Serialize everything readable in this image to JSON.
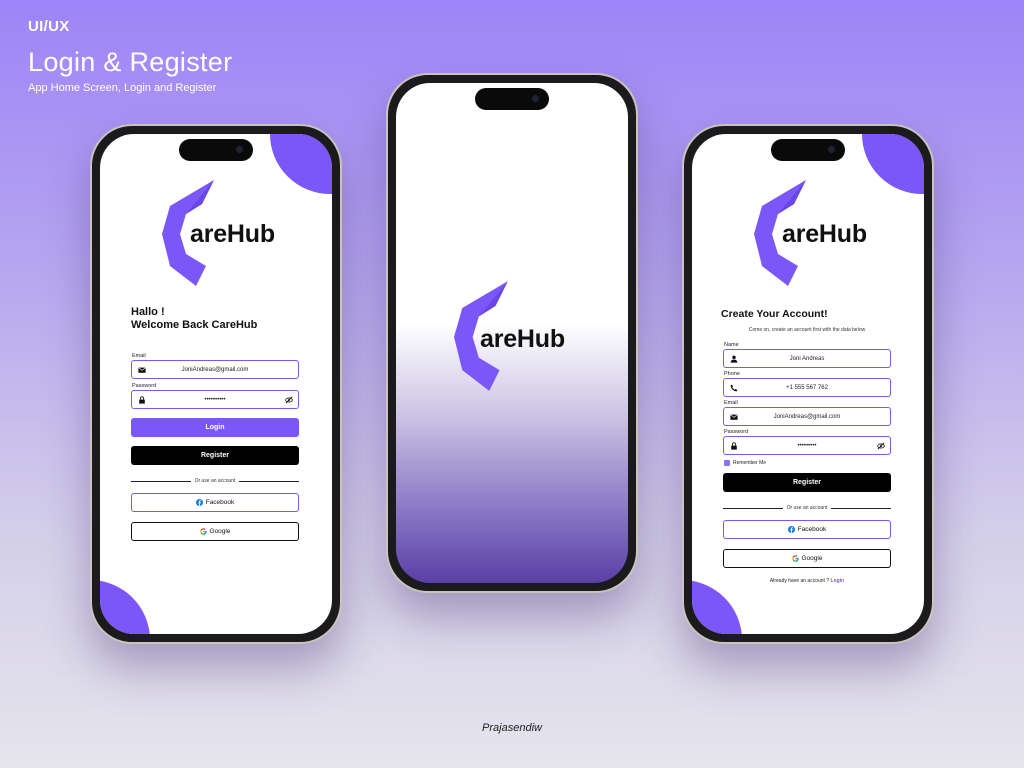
{
  "header": {
    "tag": "UI/UX",
    "title": "Login & Register",
    "subtitle": "App Home Screen, Login and Register"
  },
  "footer": {
    "author": "Prajasendiw"
  },
  "brand": {
    "name": "areHub",
    "accent": "#7c57f7",
    "dark": "#000000"
  },
  "login": {
    "greeting_line1": "Hallo !",
    "greeting_line2": "Welcome Back CareHub",
    "email_label": "Email",
    "email_value": "JoniAndreas@gmail.com",
    "password_label": "Password",
    "password_value": "••••••••••",
    "login_button": "Login",
    "register_button": "Register",
    "divider_text": "Or use an account",
    "facebook_button": "Facebook",
    "google_button": "Google"
  },
  "register": {
    "title": "Create Your Account!",
    "description": "Come on, create an account first with the data below",
    "name_label": "Name",
    "name_value": "Joni Andreas",
    "phone_label": "Phone",
    "phone_value": "+1 555 567 762",
    "email_label": "Email",
    "email_value": "JoniAndreas@gmail.com",
    "password_label": "Password",
    "password_value": "•••••••••",
    "remember_label": "Remember Me",
    "register_button": "Register",
    "divider_text": "Or use an account",
    "facebook_button": "Facebook",
    "google_button": "Google",
    "already_text": "Already have an account ?",
    "login_link": "Login"
  },
  "icons": {
    "email": "mail-icon",
    "password": "lock-icon",
    "visibility": "eye-off-icon",
    "name": "person-icon",
    "phone": "phone-icon",
    "facebook": "facebook-icon",
    "google": "google-icon"
  }
}
